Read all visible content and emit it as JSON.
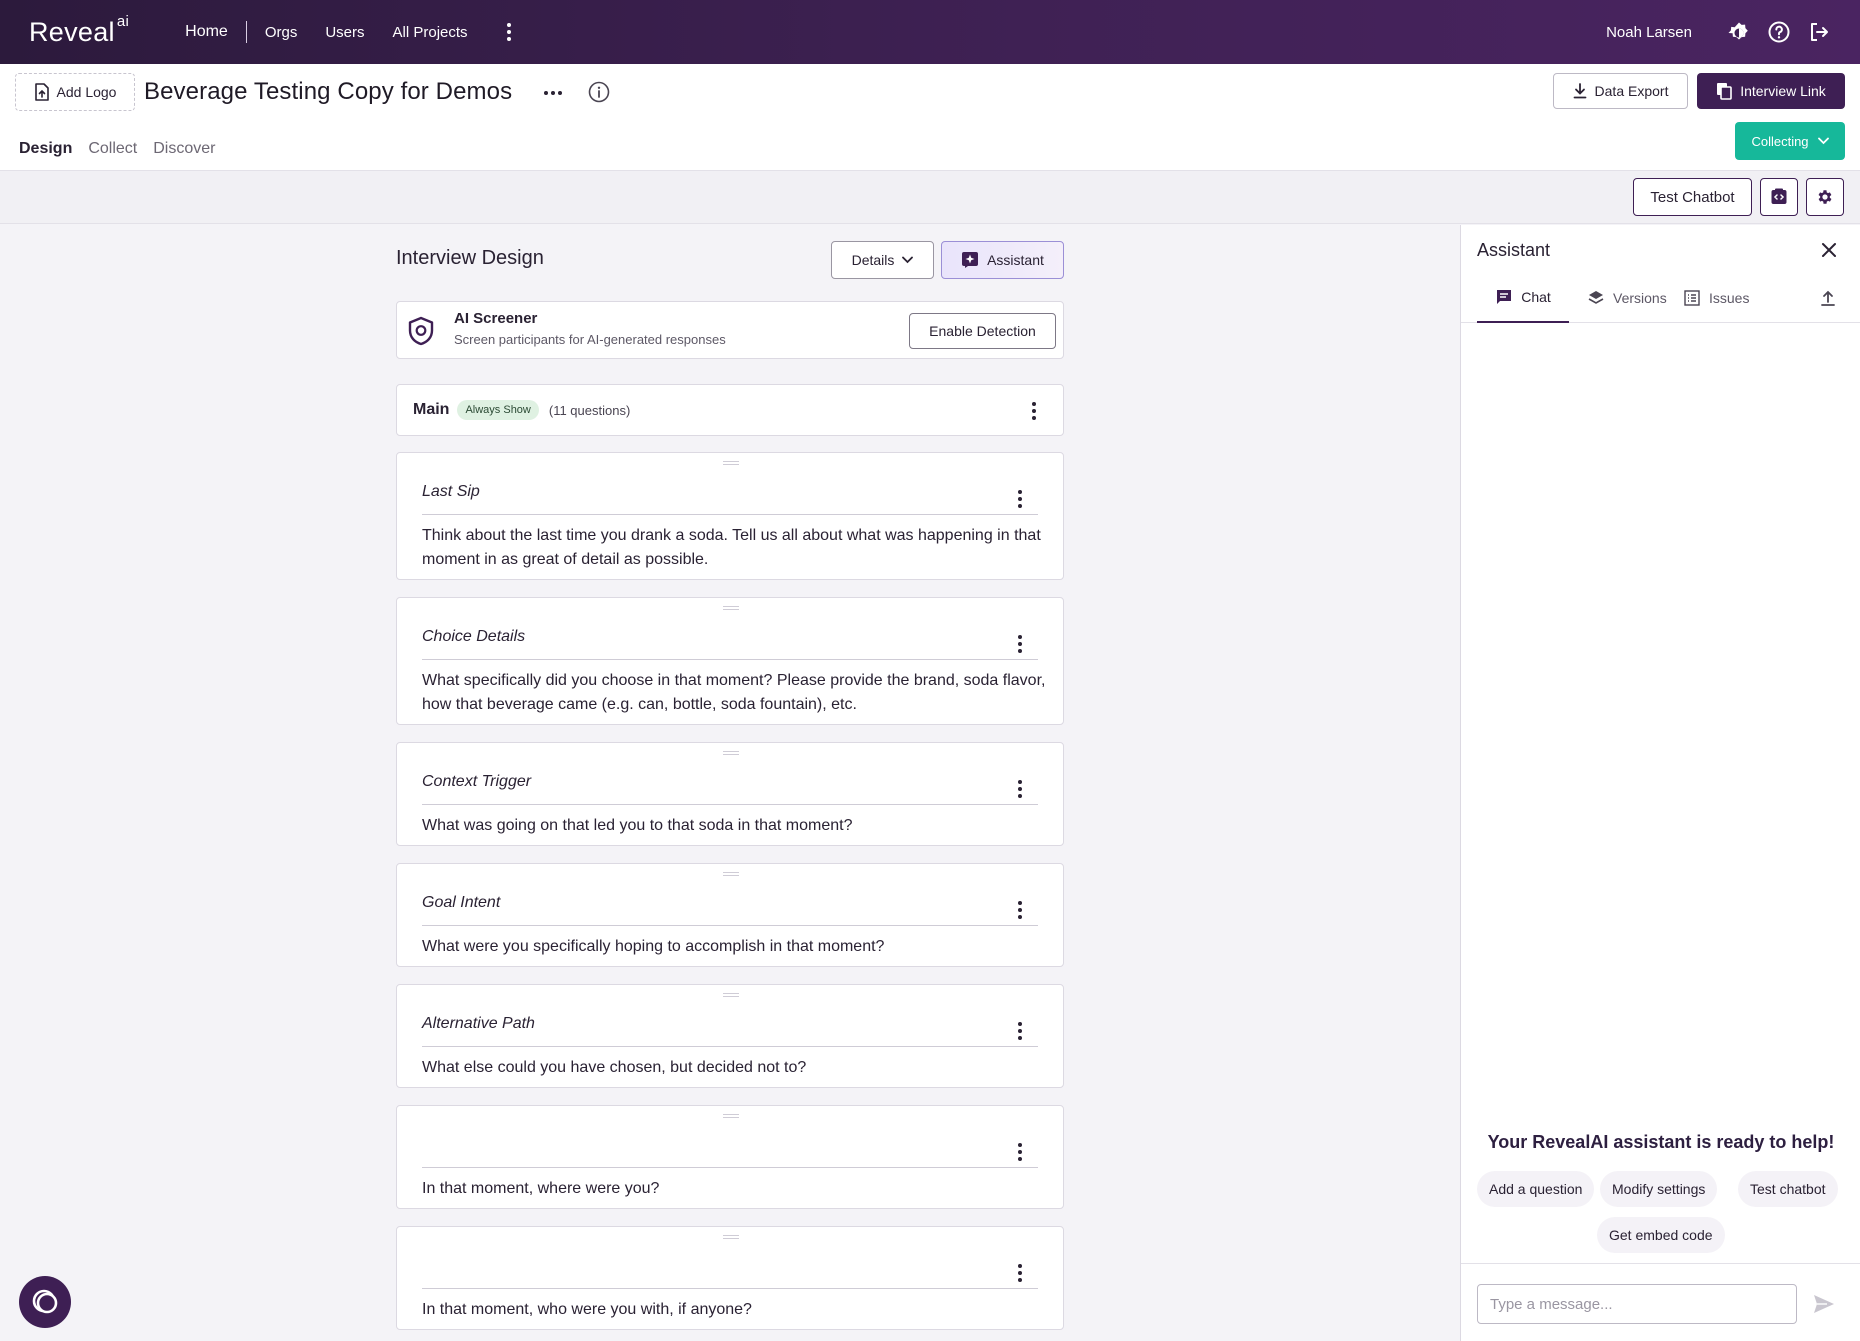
{
  "topnav": {
    "logo_text": "Reveal",
    "logo_sup": "ai",
    "items": [
      "Home",
      "Orgs",
      "Users",
      "All Projects"
    ],
    "user_name": "Noah Larsen"
  },
  "header": {
    "add_logo_label": "Add Logo",
    "project_title": "Beverage Testing Copy for Demos",
    "data_export_label": "Data Export",
    "interview_link_label": "Interview Link",
    "status_label": "Collecting",
    "tabs": [
      "Design",
      "Collect",
      "Discover"
    ],
    "active_tab": "Design"
  },
  "toolbar": {
    "test_chatbot_label": "Test Chatbot"
  },
  "design": {
    "title": "Interview Design",
    "details_label": "Details",
    "assistant_label": "Assistant",
    "screener": {
      "title": "AI Screener",
      "subtitle": "Screen participants for AI-generated responses",
      "button_label": "Enable Detection"
    },
    "section": {
      "name": "Main",
      "badge": "Always Show",
      "count": "(11 questions)"
    },
    "questions": [
      {
        "title": "Last Sip",
        "text": "Think about the last time you drank a soda. Tell us all about what was happening in that moment in as great of detail as possible."
      },
      {
        "title": "Choice Details",
        "text": "What specifically did you choose in that moment? Please provide the brand, soda flavor, how that beverage came (e.g. can, bottle, soda fountain), etc."
      },
      {
        "title": "Context Trigger",
        "text": "What was going on that led you to that soda in that moment?"
      },
      {
        "title": "Goal Intent",
        "text": "What were you specifically hoping to accomplish in that moment?"
      },
      {
        "title": "Alternative Path",
        "text": "What else could you have chosen, but decided not to?"
      },
      {
        "title": "",
        "text": "In that moment, where were you?"
      },
      {
        "title": "",
        "text": "In that moment, who were you with, if anyone?"
      }
    ]
  },
  "assistant": {
    "title": "Assistant",
    "tabs": [
      "Chat",
      "Versions",
      "Issues"
    ],
    "active_tab": "Chat",
    "ready_message": "Your RevealAI assistant is ready to help!",
    "suggestions": [
      "Add a question",
      "Modify settings",
      "Test chatbot",
      "Get embed code"
    ],
    "input_placeholder": "Type a message..."
  },
  "colors": {
    "brand_dark": "#3e1f54",
    "status_green": "#16b89a",
    "badge_green_bg": "#dff1e2"
  }
}
